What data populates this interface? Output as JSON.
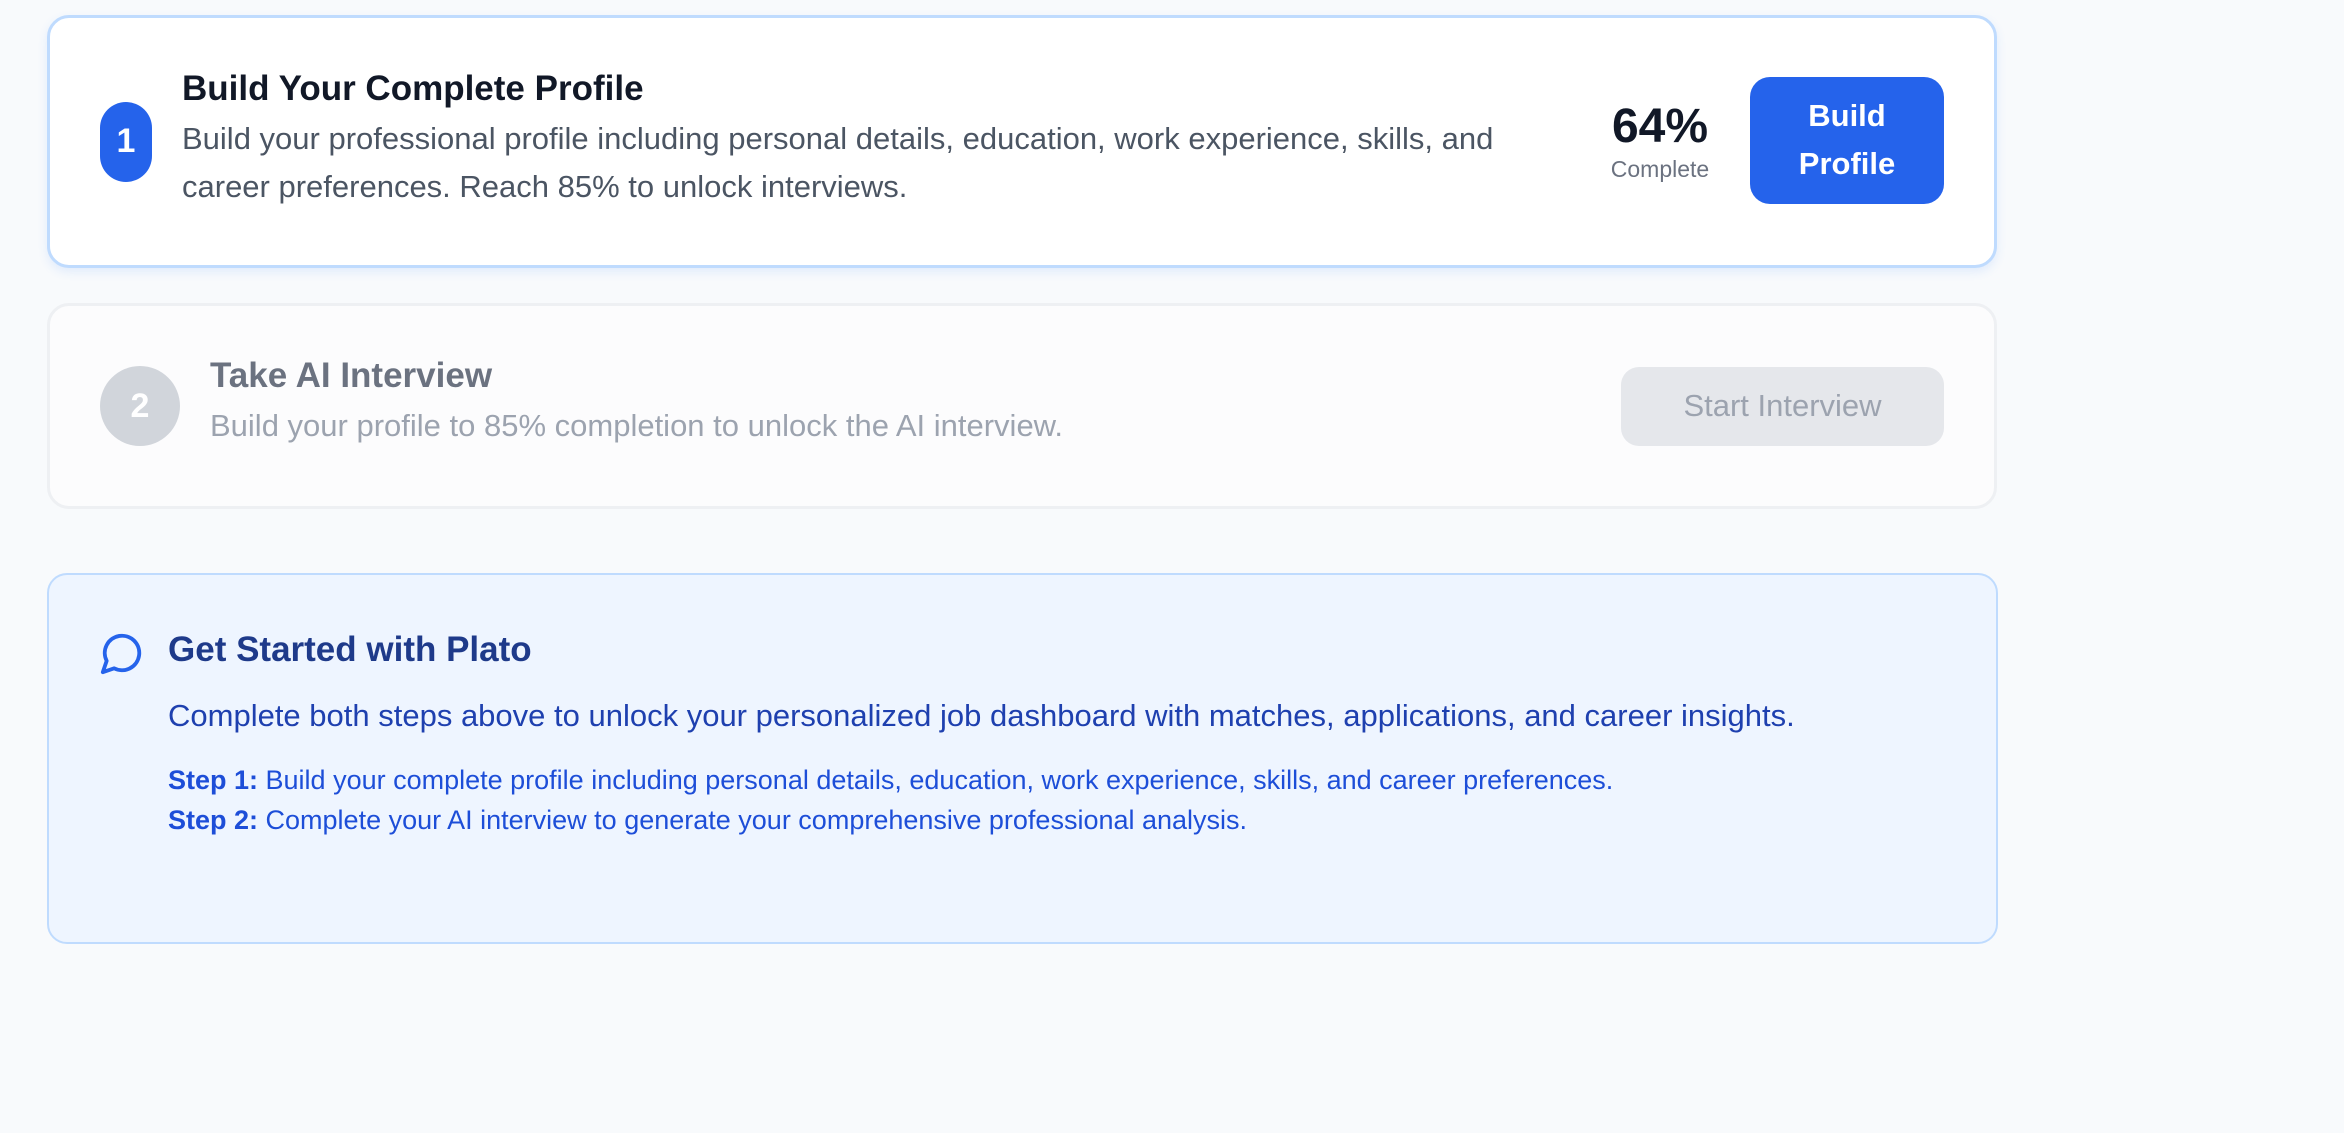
{
  "steps": [
    {
      "number": "1",
      "title": "Build Your Complete Profile",
      "description": "Build your professional profile including personal details, education, work experience, skills, and career preferences. Reach 85% to unlock interviews.",
      "progress_value": "64%",
      "progress_label": "Complete",
      "button_label": "Build Profile",
      "state": "active"
    },
    {
      "number": "2",
      "title": "Take AI Interview",
      "description": "Build your profile to 85% completion to unlock the AI interview.",
      "button_label": "Start Interview",
      "state": "locked"
    }
  ],
  "info": {
    "icon": "chat-bubble-icon",
    "title": "Get Started with Plato",
    "description": "Complete both steps above to unlock your personalized job dashboard with matches, applications, and career insights.",
    "step1_label": "Step 1:",
    "step1_text": " Build your complete profile including personal details, education, work experience, skills, and career preferences.",
    "step2_label": "Step 2:",
    "step2_text": " Complete your AI interview to generate your comprehensive professional analysis."
  },
  "colors": {
    "accent": "#2563eb",
    "info_background": "#eef5ff",
    "info_text": "#1e40af",
    "disabled": "#e5e7eb"
  }
}
